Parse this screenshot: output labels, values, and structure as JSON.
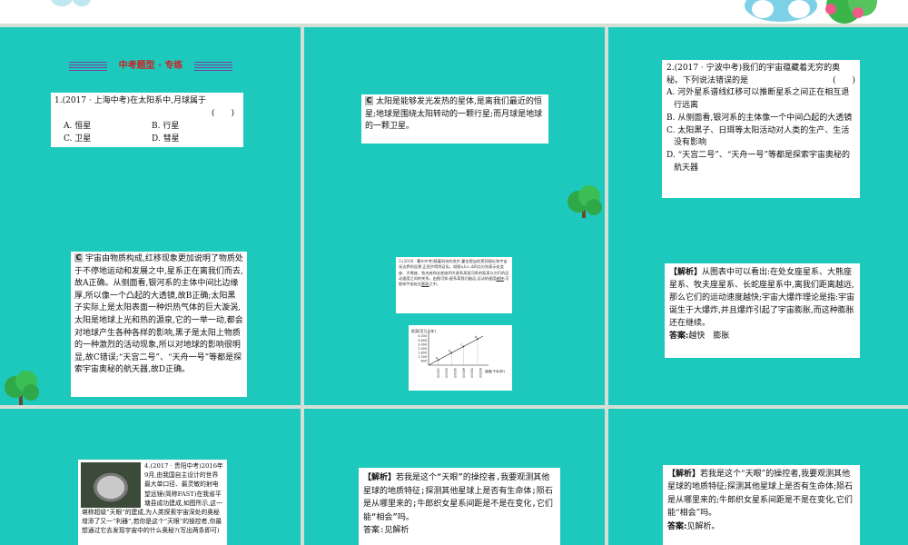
{
  "slides": {
    "s1": {
      "banner": "中考题型 · 专练",
      "question": "1.(2017 · 上海中考)在太阳系中,月球属于",
      "blank": "(　　)",
      "options": [
        "A. 恒星",
        "B. 行星",
        "C. 卫星",
        "D. 彗星"
      ]
    },
    "s2": {
      "badge": "C",
      "text": "太阳是能够发光发热的星体,是离我们最近的恒星;地球是围绕太阳转动的一颗行星;而月球是地球的一颗卫星。"
    },
    "s3": {
      "question": "2.(2017 · 宁波中考)我们的宇宙蕴藏着无穷的奥秘。下列说法错误的是",
      "blank": "(　　)",
      "options": [
        "A. 河外星系谱线红移可以推断星系之间正在相互退行远离",
        "B. 从侧面看,银河系的主体像一个中间凸起的大透镜",
        "C. 太阳黑子、日珥等太阳活动对人类的生产、生活没有影响",
        "D. “天宫二号”、“天舟一号”等都是探索宇宙奥秘的航天器"
      ]
    },
    "s4": {
      "badge": "C",
      "text": "宇宙由物质构成,红移现象更加说明了物质处于不停地运动和发展之中,星系正在离我们而去,故A正确。从侧面看,银河系的主体中间比边缘厚,所以像一个凸起的大透镜,故B正确;太阳黑子实际上是太阳表面一种炽热气体的巨大漩涡,太阳是地球上光和热的源泉,它的一举一动,都会对地球产生各种各样的影响,黑子是太阳上物质的一种激烈的活动现象,所以对地球的影响很明显,故C错误;“天宫二号”、“天舟一号”等都是探索宇宙奥秘的航天器,故D正确。"
    },
    "s5": {
      "question": "3.(2016 · 衢州中考)随着科技的进步,霍金提出的黑洞理论和宇宙无边界的设想,正逐步得到证实。如图a,b,c,d四点分别表示处女座、大熊座、牧夫座和长蛇座四大星系离银河系的距离与它们的运动速度之间的关系。由图可知:星系离我们越远,运动的速度",
      "blank1": "越快",
      "tail": ";可推知宇宙处在",
      "blank2": "膨胀",
      "tail2": "之中。",
      "chart_ylabel": "距离(百万光年)",
      "chart_yticks": [
        "4 200",
        "3 600",
        "3 000",
        "2 400",
        "1 800",
        "1 200",
        "600"
      ],
      "chart_xlabel": "速度(千米/秒)",
      "chart_xticks": [
        "10000",
        "20000",
        "30000",
        "40000",
        "50000",
        "60000"
      ],
      "chart_points": [
        "a",
        "b",
        "c",
        "d"
      ]
    },
    "s6": {
      "label": "【解析】",
      "text": "从图表中可以看出:在处女座星系、大熊座星系、牧夫座星系、长蛇座星系中,离我们距离越远,那么它们的运动速度越快;宇宙大爆炸理论是指:宇宙诞生于大爆炸,并且爆炸引起了宇宙膨胀,而这种膨胀还在继续。",
      "answer_label": "答案:",
      "answer": "越快　膨胀"
    },
    "s7": {
      "text": "4.(2017 · 贵阳中考)2016年9月,由我国自主设计的世界最大单口径、最灵敏的射电望远镜(简称FAST)在我省平塘县成功建成,如图所示,这一堪称超级“天眼”的建成,为人类探索宇宙深处的奥秘增添了又一“利器”,若你是这个“天眼”的操控者,你最想通过它去发现宇宙中的什么奥秘?(写出两条即可)"
    },
    "s8": {
      "label": "【解析】",
      "text": "若我是这个“天眼”的操控者,我要观测其他星球的地质特征;探测其他星球上是否有生命体;陨石是从哪里来的;牛郎织女星系间距是不是在变化,它们能“相会”吗。",
      "answer": "答案:见解析"
    },
    "s9": {
      "label": "【解析】",
      "text": "若我是这个“天眼”的操控者,我要观测其他星球的地质特征;探测其他星球上是否有生命体;陨石是从哪里来的;牛郎织女星系间距是不是在变化,它们能“相会”吗。",
      "answer_label": "答案:",
      "answer": "见解析。"
    }
  }
}
